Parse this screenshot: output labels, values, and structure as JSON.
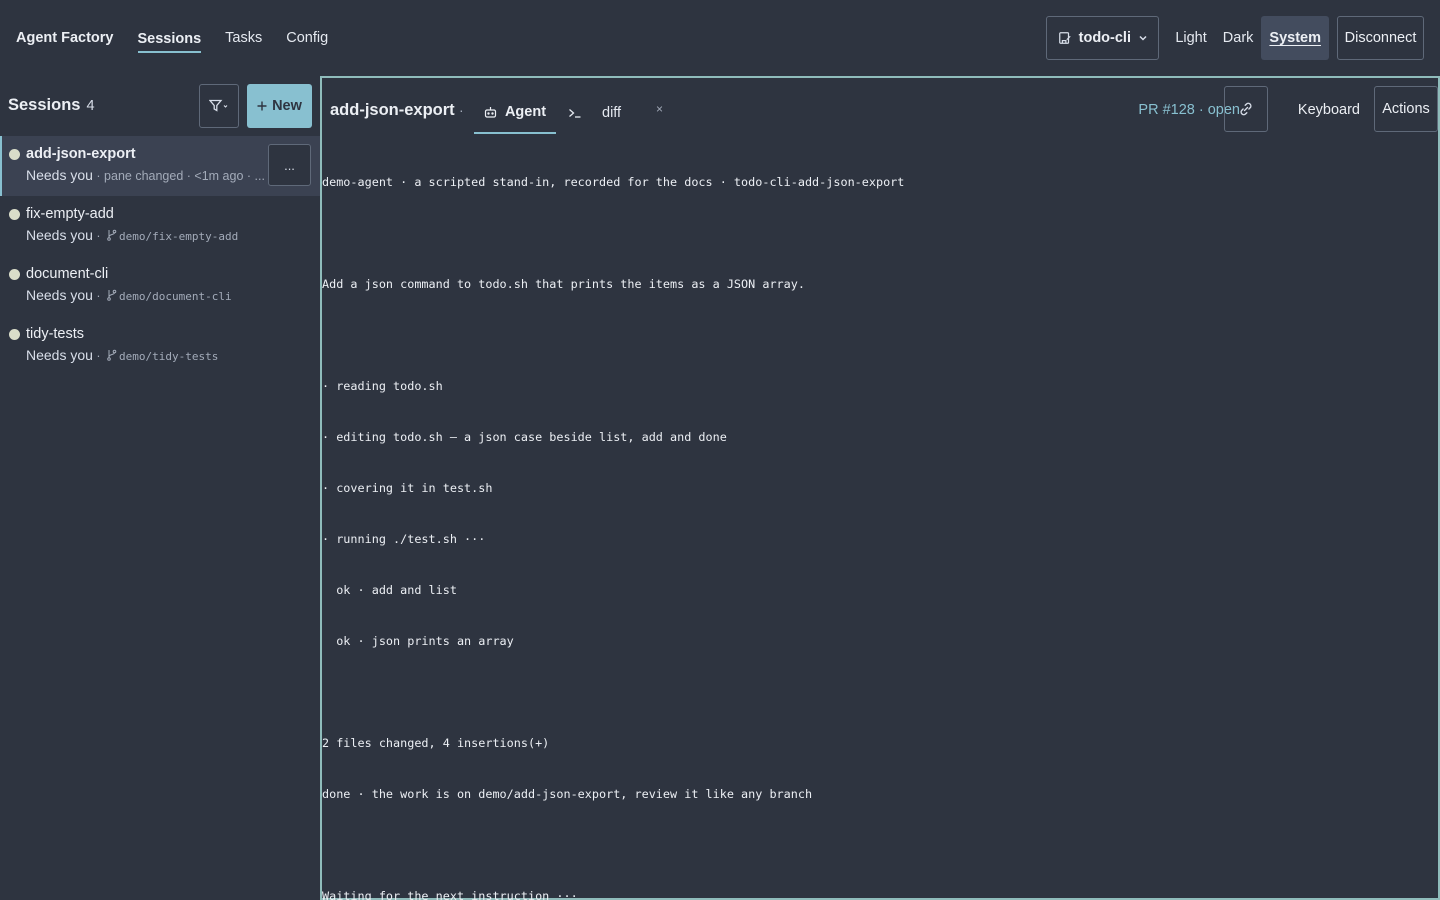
{
  "topbar": {
    "brand": "Agent Factory",
    "nav": [
      {
        "label": "Sessions",
        "active": true
      },
      {
        "label": "Tasks",
        "active": false
      },
      {
        "label": "Config",
        "active": false
      }
    ],
    "repo": "todo-cli",
    "themes": [
      {
        "label": "Light",
        "active": false
      },
      {
        "label": "Dark",
        "active": false
      },
      {
        "label": "System",
        "active": true
      }
    ],
    "disconnect_label": "Disconnect"
  },
  "sidebar": {
    "title": "Sessions",
    "count": "4",
    "new_label": "New",
    "more_label": "...",
    "sessions": [
      {
        "name": "add-json-export",
        "status": "Needs you",
        "sep": " · ",
        "info": "pane changed · <1m ago · ...",
        "branch": "",
        "active": true
      },
      {
        "name": "fix-empty-add",
        "status": "Needs you",
        "sep": " · ",
        "info": "",
        "branch": "demo/fix-empty-add",
        "active": false
      },
      {
        "name": "document-cli",
        "status": "Needs you",
        "sep": " · ",
        "info": "",
        "branch": "demo/document-cli",
        "active": false
      },
      {
        "name": "tidy-tests",
        "status": "Needs you",
        "sep": " · ",
        "info": "",
        "branch": "demo/tidy-tests",
        "active": false
      }
    ]
  },
  "main": {
    "title": "add-json-export",
    "title_sep": "·",
    "tabs": {
      "agent": "Agent",
      "diff": "diff",
      "close": "×"
    },
    "pr_status": "PR #128 · open",
    "keyboard_label": "Keyboard",
    "actions_label": "Actions",
    "terminal_lines": [
      "demo-agent · a scripted stand-in, recorded for the docs · todo-cli-add-json-export",
      "",
      "Add a json command to todo.sh that prints the items as a JSON array.",
      "",
      "· reading todo.sh",
      "· editing todo.sh — a json case beside list, add and done",
      "· covering it in test.sh",
      "· running ./test.sh ···",
      "  ok · add and list",
      "  ok · json prints an array",
      "",
      "2 files changed, 4 insertions(+)",
      "done · the work is on demo/add-json-export, review it like any branch",
      "",
      "Waiting for the next instruction ···"
    ]
  },
  "colors": {
    "background": "#2e3440",
    "accent": "#88c0d0",
    "active_row": "#3b4252",
    "status_dot": "#d9ddc9"
  },
  "icons": {
    "repo": "repo-icon",
    "chevron": "chevron-down-icon",
    "filter": "filter-icon",
    "plus": "plus-icon",
    "branch": "git-branch-icon",
    "agent": "robot-icon",
    "terminal": "terminal-prompt-icon",
    "link": "link-icon"
  }
}
